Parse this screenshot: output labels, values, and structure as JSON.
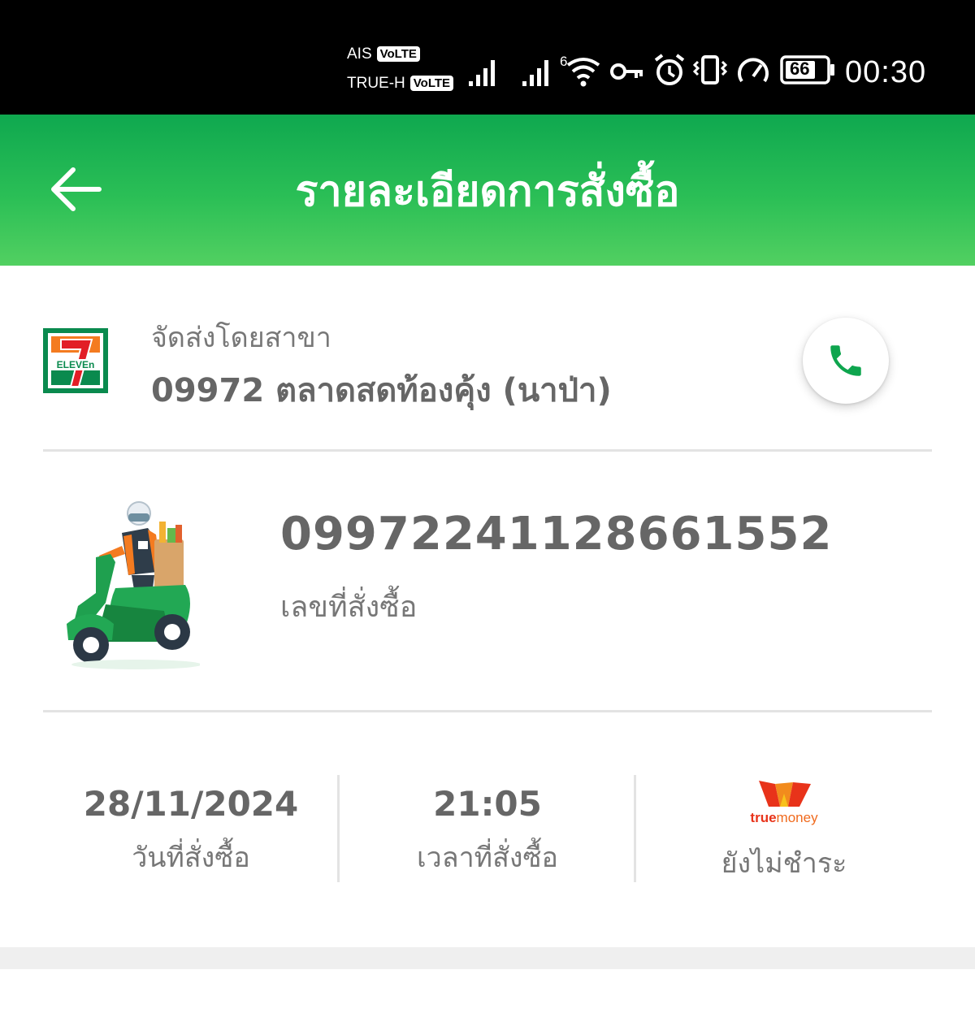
{
  "status_bar": {
    "carrier1": "AIS",
    "carrier2": "TRUE-H",
    "volte_label": "VoLTE",
    "network_generation": "6",
    "battery": "66",
    "time": "00:30",
    "icons": [
      "signal-icon",
      "signal-icon",
      "wifi-icon",
      "vpn-key-icon",
      "alarm-icon",
      "vibrate-icon",
      "speed-icon",
      "battery-icon"
    ]
  },
  "header": {
    "title": "รายละเอียดการสั่งซื้อ",
    "back_icon": "arrow-left-icon",
    "background": "#1cb453"
  },
  "store": {
    "brand": "7-ELEVEn",
    "caption": "จัดส่งโดยสาขา",
    "name": "09972 ตลาดสดท้องคุ้ง (นาป่า)",
    "call_icon": "phone-icon",
    "accent_color": "#0ea54e"
  },
  "order": {
    "number": "09972241128661552",
    "number_label": "เลขที่สั่งซื้อ"
  },
  "details": {
    "date": "28/11/2024",
    "date_label": "วันที่สั่งซื้อ",
    "time": "21:05",
    "time_label": "เวลาที่สั่งซื้อ",
    "payment_logo_text1": "true",
    "payment_logo_text2": "money",
    "payment_status": "ยังไม่ชำระ"
  }
}
